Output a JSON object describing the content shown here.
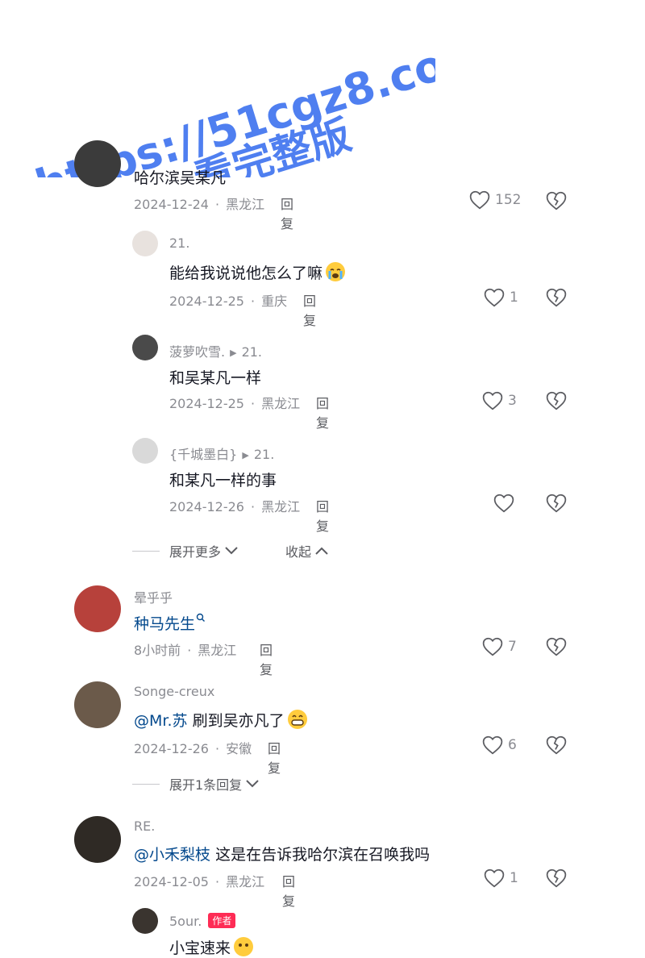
{
  "watermark": {
    "line1": "https://51cgz8.com",
    "line2": "看完整版",
    "color": "#4f7ff0"
  },
  "comments": [
    {
      "text": "哈尔滨吴某凡",
      "date": "2024-12-24",
      "region": "黑龙江",
      "reply": "回复",
      "likes": "152"
    },
    {
      "user": "21.",
      "text": "能给我说说他怎么了嘛",
      "date": "2024-12-25",
      "region": "重庆",
      "reply": "回复",
      "likes": "1"
    },
    {
      "user": "菠萝吹雪.",
      "reply_to": "21.",
      "text": "和吴某凡一样",
      "date": "2024-12-25",
      "region": "黑龙江",
      "reply": "回复",
      "likes": "3"
    },
    {
      "user": "{千城墨白}",
      "reply_to": "21.",
      "text": "和某凡一样的事",
      "date": "2024-12-26",
      "region": "黑龙江",
      "reply": "回复",
      "likes": ""
    },
    {
      "user": "晕乎乎",
      "text": "种马先生",
      "date": "8小时前",
      "region": "黑龙江",
      "reply": "回复",
      "likes": "7"
    },
    {
      "user": "Songe-creux",
      "mention": "@Mr.苏",
      "text": "刷到吴亦凡了",
      "date": "2024-12-26",
      "region": "安徽",
      "reply": "回复",
      "likes": "6"
    },
    {
      "user": "RE.",
      "mention": "@小禾梨枝",
      "text": "这是在告诉我哈尔滨在召唤我吗",
      "date": "2024-12-05",
      "region": "黑龙江",
      "reply": "回复",
      "likes": "1"
    },
    {
      "user": "5our.",
      "badge": "作者",
      "text": "小宝速来"
    }
  ],
  "expand_more": "展开更多",
  "collapse": "收起",
  "expand_one": "展开1条回复",
  "icons": {
    "like": "heart-outline-icon",
    "dislike": "broken-heart-icon",
    "chevron_down": "chevron-down-icon",
    "chevron_up": "chevron-up-icon",
    "search_hint": "search-icon"
  }
}
